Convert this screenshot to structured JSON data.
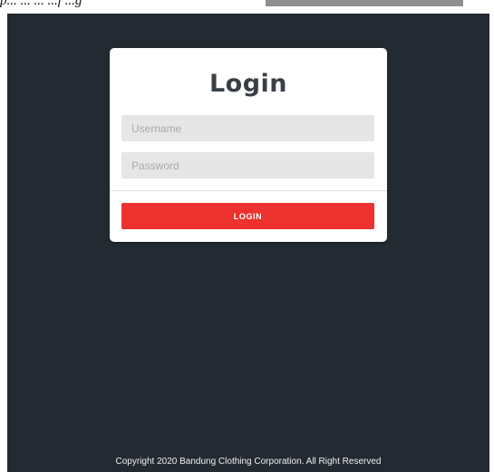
{
  "header_fragment": {
    "text": "p... ... ... ...f ...g"
  },
  "login": {
    "title": "Login",
    "username_placeholder": "Username",
    "password_placeholder": "Password",
    "button_label": "LOGIN"
  },
  "footer": {
    "copyright": "Copyright 2020 Bandung Clothing Corporation. All Right Reserved"
  },
  "colors": {
    "page_background": "#232a31",
    "card_background": "#ffffff",
    "field_background": "#e6e6e6",
    "button_background": "#ec312e",
    "button_text": "#ffffff",
    "title_text": "#3a3f47"
  }
}
